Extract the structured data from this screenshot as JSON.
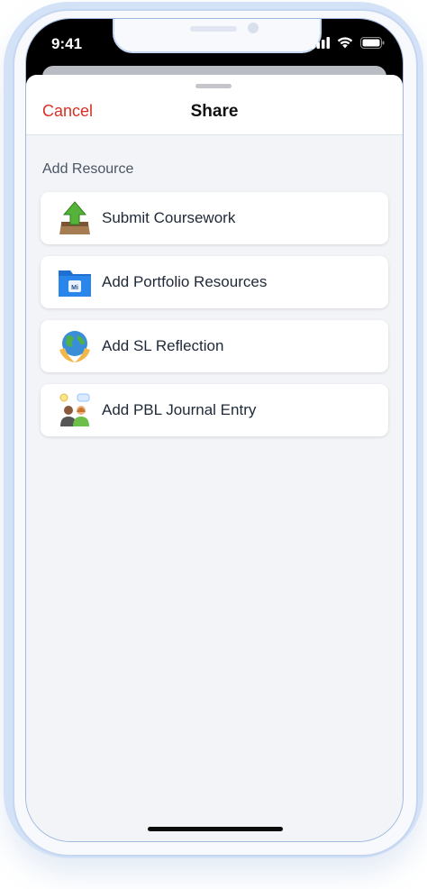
{
  "status_bar": {
    "time": "9:41"
  },
  "sheet": {
    "cancel_label": "Cancel",
    "title": "Share"
  },
  "section": {
    "label": "Add Resource"
  },
  "items": [
    {
      "label": "Submit Coursework",
      "icon": "upload-tray-icon"
    },
    {
      "label": "Add Portfolio Resources",
      "icon": "portfolio-folder-icon"
    },
    {
      "label": "Add SL Reflection",
      "icon": "globe-hands-icon"
    },
    {
      "label": "Add PBL Journal Entry",
      "icon": "people-discussion-icon"
    }
  ],
  "colors": {
    "accent_cancel": "#d93025",
    "background": "#f2f4f8",
    "card": "#ffffff"
  }
}
